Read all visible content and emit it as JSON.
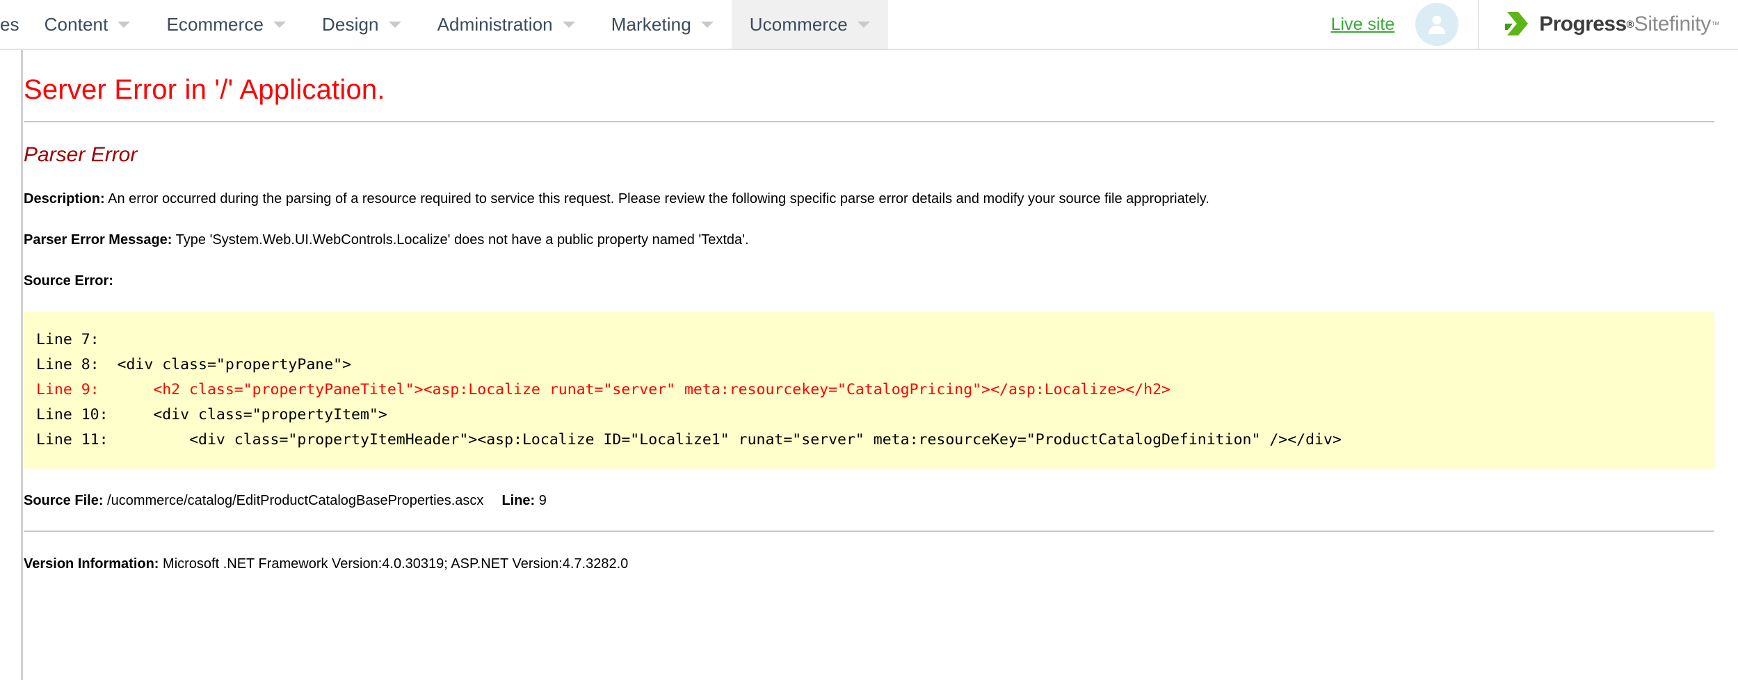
{
  "nav": {
    "items": [
      {
        "label": "es",
        "caret": false,
        "active": false,
        "truncated": true
      },
      {
        "label": "Content",
        "caret": true,
        "active": false,
        "truncated": false
      },
      {
        "label": "Ecommerce",
        "caret": true,
        "active": false,
        "truncated": false
      },
      {
        "label": "Design",
        "caret": true,
        "active": false,
        "truncated": false
      },
      {
        "label": "Administration",
        "caret": true,
        "active": false,
        "truncated": false
      },
      {
        "label": "Marketing",
        "caret": true,
        "active": false,
        "truncated": false
      },
      {
        "label": "Ucommerce",
        "caret": true,
        "active": true,
        "truncated": false
      }
    ],
    "live_site_label": "Live site",
    "live_site_color": "#3aa93a",
    "avatar_icon": "user-avatar-icon",
    "brand": {
      "mark_icon": "progress-arrow-logo",
      "name": "Progress",
      "registered": "®",
      "product": "Sitefinity",
      "trademark": "™",
      "accent_color": "#5cb615"
    }
  },
  "error": {
    "title": "Server Error in '/' Application.",
    "title_color": "#ff0000",
    "subtitle": "Parser Error",
    "subtitle_color": "#9d0000",
    "description_label": "Description:",
    "description_text": "An error occurred during the parsing of a resource required to service this request. Please review the following specific parse error details and modify your source file appropriately.",
    "parser_error_label": "Parser Error Message:",
    "parser_error_text": "Type 'System.Web.UI.WebControls.Localize' does not have a public property named 'Textda'.",
    "source_error_label": "Source Error:",
    "code_background": "#ffffcc",
    "code_lines": [
      {
        "text": "Line 7:  ",
        "highlight": false
      },
      {
        "text": "Line 8:  <div class=\"propertyPane\">",
        "highlight": false
      },
      {
        "text": "Line 9:      <h2 class=\"propertyPaneTitel\"><asp:Localize runat=\"server\" meta:resourcekey=\"CatalogPricing\"></asp:Localize></h2>",
        "highlight": true
      },
      {
        "text": "Line 10:     <div class=\"propertyItem\">",
        "highlight": false
      },
      {
        "text": "Line 11:         <div class=\"propertyItemHeader\"><asp:Localize ID=\"Localize1\" runat=\"server\" meta:resourceKey=\"ProductCatalogDefinition\" /></div>",
        "highlight": false
      }
    ],
    "source_file_label": "Source File:",
    "source_file_value": "/ucommerce/catalog/EditProductCatalogBaseProperties.ascx",
    "line_label": "Line:",
    "line_value": "9",
    "version_label": "Version Information:",
    "version_value": "Microsoft .NET Framework Version:4.0.30319; ASP.NET Version:4.7.3282.0"
  }
}
